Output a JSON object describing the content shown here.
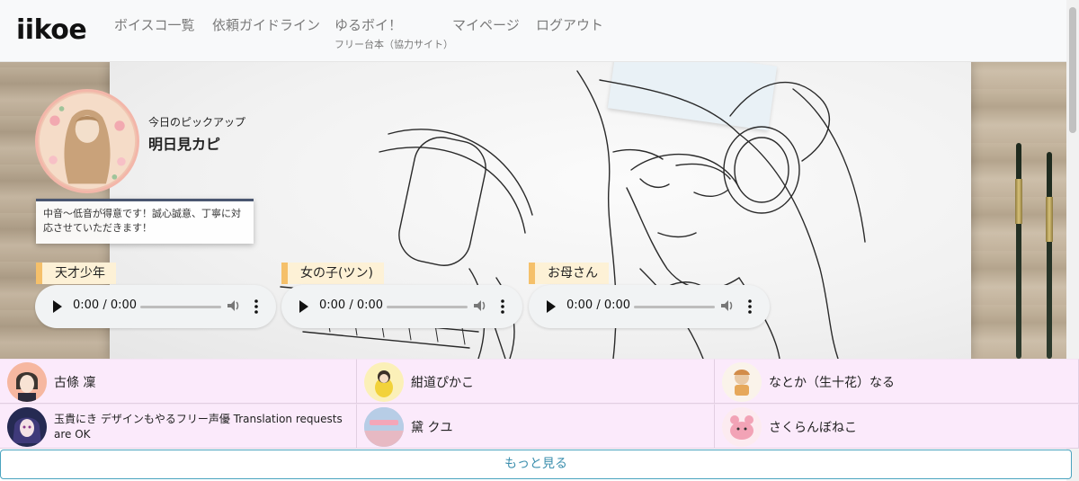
{
  "nav": {
    "brand": "iikoe",
    "items": [
      {
        "label": "ボイスコ一覧"
      },
      {
        "label": "依頼ガイドライン"
      },
      {
        "label": "ゆるボイ！",
        "sub": "フリー台本（協力サイト）"
      },
      {
        "label": "マイページ"
      },
      {
        "label": "ログアウト"
      }
    ]
  },
  "pickup": {
    "label": "今日のピックアップ",
    "name": "明日見カピ",
    "description": "中音～低音が得意です！誠心誠意、丁寧に対応させていただきます！",
    "samples": [
      {
        "label": "天才少年",
        "time": "0:00 / 0:00"
      },
      {
        "label": "女の子(ツン)",
        "time": "0:00 / 0:00"
      },
      {
        "label": "お母さん",
        "time": "0:00 / 0:00"
      }
    ]
  },
  "voices": [
    {
      "name": "古條 凜"
    },
    {
      "name": "紺道ぴかこ"
    },
    {
      "name": "なとか（生十花）なる"
    },
    {
      "name": "玉貴にき デザインもやるフリー声優 Translation requests are OK"
    },
    {
      "name": "黛 クユ"
    },
    {
      "name": "さくらんぼねこ"
    }
  ],
  "more_label": "もっと見る",
  "colors": {
    "accent_label": "#f5c06a",
    "cell_bg": "#fbeafb",
    "more_button": "#3c8fae"
  }
}
